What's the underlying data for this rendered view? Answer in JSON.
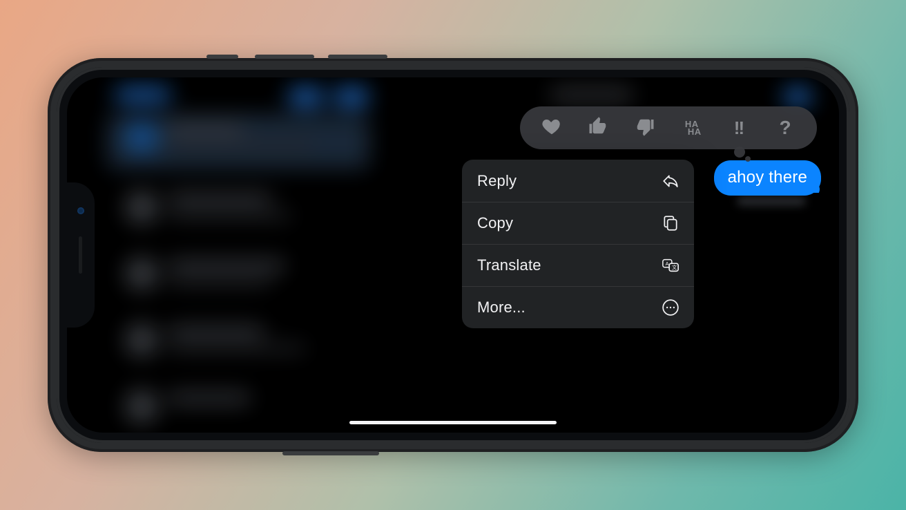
{
  "message": {
    "text": "ahoy there"
  },
  "tapback": {
    "items": [
      {
        "name": "heart"
      },
      {
        "name": "thumbs-up"
      },
      {
        "name": "thumbs-down"
      },
      {
        "name": "haha",
        "label_top": "HA",
        "label_bottom": "HA"
      },
      {
        "name": "exclamation",
        "glyph": "!!"
      },
      {
        "name": "question",
        "glyph": "?"
      }
    ]
  },
  "menu": {
    "items": [
      {
        "label": "Reply",
        "icon": "reply"
      },
      {
        "label": "Copy",
        "icon": "copy"
      },
      {
        "label": "Translate",
        "icon": "translate"
      },
      {
        "label": "More...",
        "icon": "more"
      }
    ]
  },
  "colors": {
    "bubble": "#0b84ff",
    "menu_bg": "#222426"
  }
}
